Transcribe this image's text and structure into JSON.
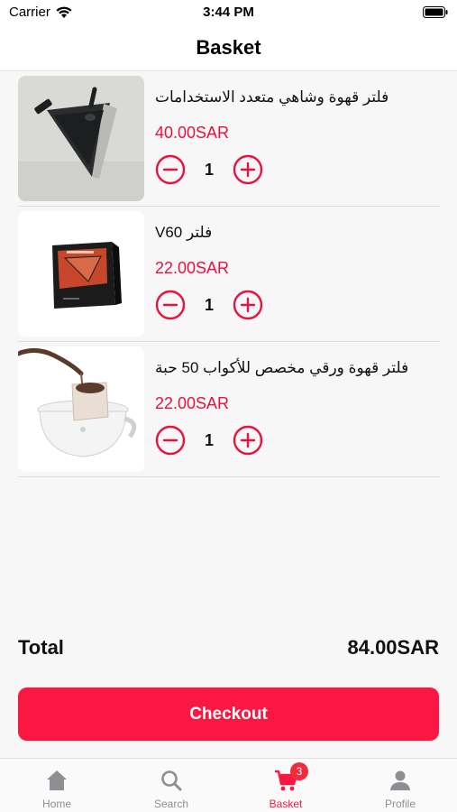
{
  "status_bar": {
    "carrier": "Carrier",
    "time": "3:44 PM"
  },
  "header": {
    "title": "Basket"
  },
  "items": [
    {
      "name": "فلتر قهوة وشاهي متعدد الاستخدامات",
      "price": "40.00SAR",
      "quantity": "1",
      "image": "cone-filter"
    },
    {
      "name": "فلتر V60",
      "price": "22.00SAR",
      "quantity": "1",
      "image": "filter-box"
    },
    {
      "name": "فلتر قهوة ورقي مخصص للأكواب 50 حبة",
      "price": "22.00SAR",
      "quantity": "1",
      "image": "drip-bag-cup"
    }
  ],
  "summary": {
    "total_label": "Total",
    "total_value": "84.00SAR"
  },
  "checkout_label": "Checkout",
  "tabs": [
    {
      "label": "Home",
      "icon": "home-icon"
    },
    {
      "label": "Search",
      "icon": "search-icon"
    },
    {
      "label": "Basket",
      "icon": "cart-icon",
      "badge": "3",
      "active": true
    },
    {
      "label": "Profile",
      "icon": "person-icon"
    }
  ],
  "colors": {
    "accent": "#fa1843",
    "price": "#e9123f",
    "inactive_tab": "#8e8e93"
  }
}
